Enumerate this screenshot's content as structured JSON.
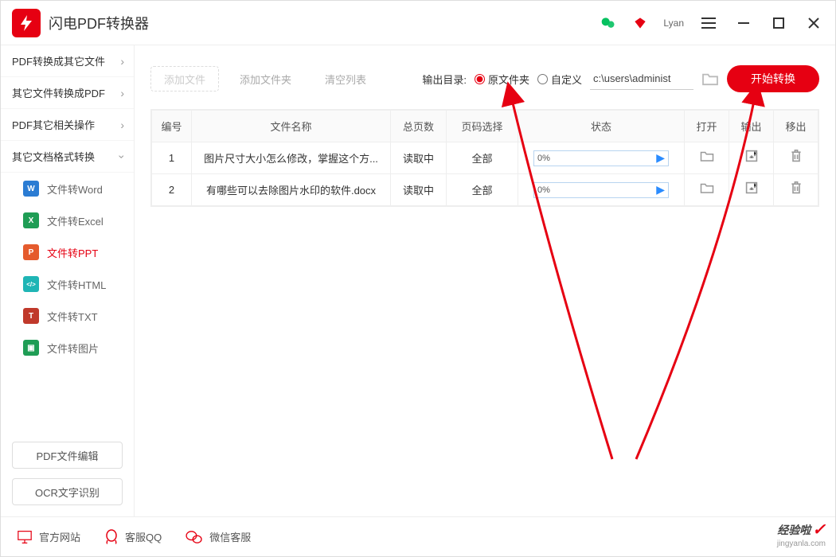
{
  "app": {
    "title": "闪电PDF转换器",
    "user": "Lyan"
  },
  "sidebar": {
    "groups": [
      {
        "label": "PDF转换成其它文件"
      },
      {
        "label": "其它文件转换成PDF"
      },
      {
        "label": "PDF其它相关操作"
      },
      {
        "label": "其它文档格式转换"
      }
    ],
    "subs": [
      {
        "label": "文件转Word",
        "color": "#2b7cd3",
        "letter": "W"
      },
      {
        "label": "文件转Excel",
        "color": "#1f9d55",
        "letter": "X"
      },
      {
        "label": "文件转PPT",
        "color": "#e55b2d",
        "letter": "P"
      },
      {
        "label": "文件转HTML",
        "color": "#1fb5b5",
        "letter": "</>"
      },
      {
        "label": "文件转TXT",
        "color": "#c0392b",
        "letter": "T"
      },
      {
        "label": "文件转图片",
        "color": "#1f9d55",
        "letter": "▣"
      }
    ],
    "extra": [
      {
        "label": "PDF文件编辑"
      },
      {
        "label": "OCR文字识别"
      }
    ]
  },
  "toolbar": {
    "add_file": "添加文件",
    "add_folder": "添加文件夹",
    "clear": "清空列表",
    "output_label": "输出目录:",
    "radio_original": "原文件夹",
    "radio_custom": "自定义",
    "path_value": "c:\\users\\administ",
    "start": "开始转换"
  },
  "table": {
    "headers": {
      "num": "编号",
      "name": "文件名称",
      "pages": "总页数",
      "sel": "页码选择",
      "status": "状态",
      "open": "打开",
      "export": "输出",
      "remove": "移出"
    },
    "rows": [
      {
        "num": "1",
        "name": "图片尺寸大小怎么修改，掌握这个方...",
        "pages": "读取中",
        "sel": "全部",
        "progress": "0%"
      },
      {
        "num": "2",
        "name": "有哪些可以去除图片水印的软件.docx",
        "pages": "读取中",
        "sel": "全部",
        "progress": "0%"
      }
    ]
  },
  "footer": {
    "site": "官方网站",
    "qq": "客服QQ",
    "wechat": "微信客服"
  },
  "watermark": {
    "main": "经验啦",
    "sub": "jingyanla.com"
  }
}
